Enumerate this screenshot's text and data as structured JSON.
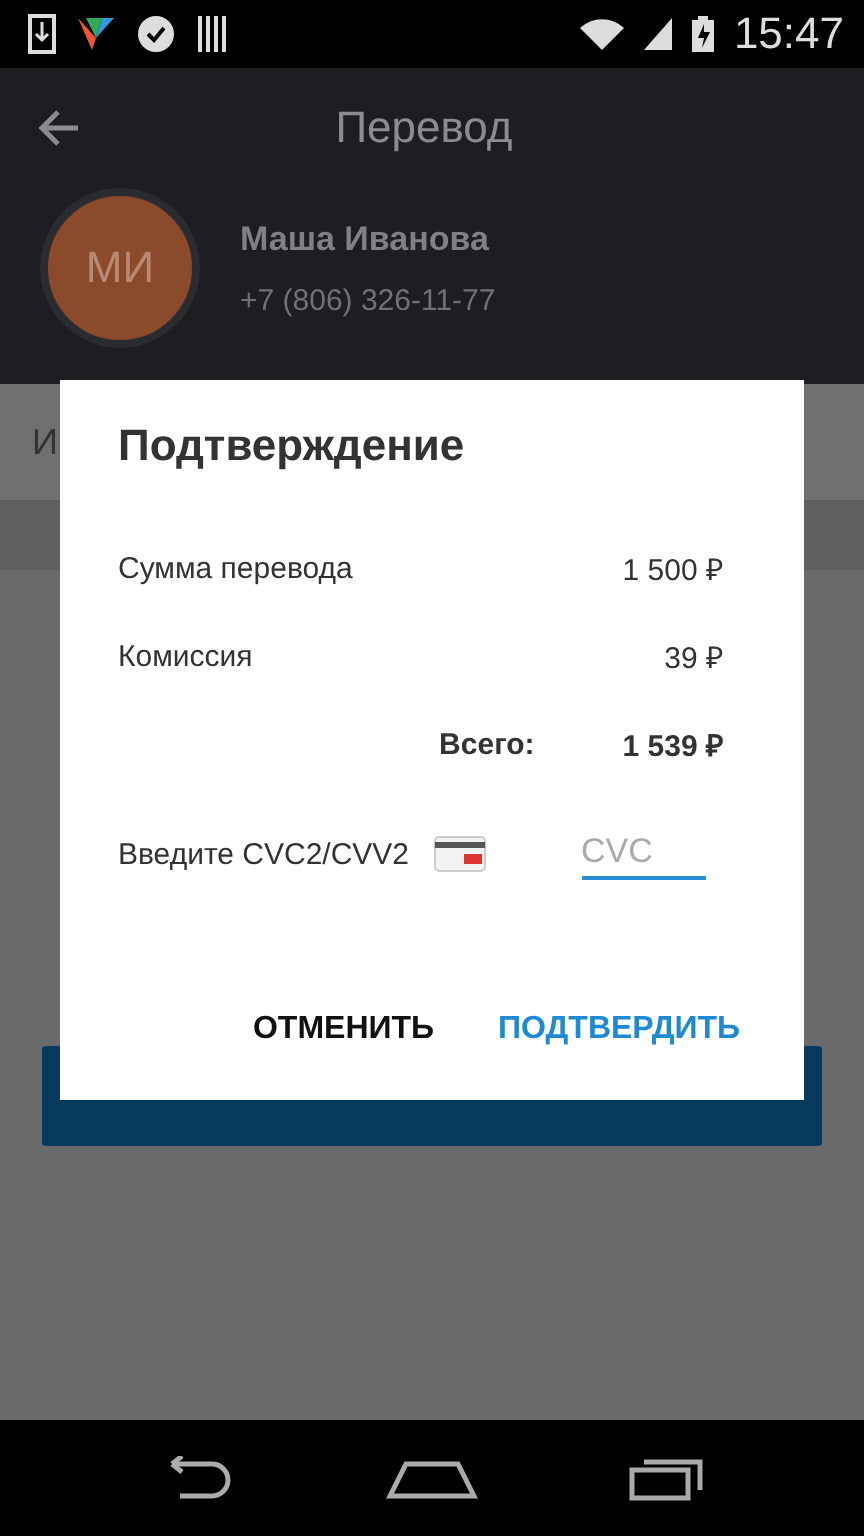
{
  "status_bar": {
    "time": "15:47"
  },
  "toolbar": {
    "title": "Перевод"
  },
  "contact": {
    "initials": "МИ",
    "name": "Маша Иванова",
    "phone": "+7 (806) 326-11-77"
  },
  "tab_row": {
    "label": "И"
  },
  "dialog": {
    "title": "Подтверждение",
    "rows": [
      {
        "kind": "line",
        "label": "Сумма перевода",
        "value": "1 500 ₽"
      },
      {
        "kind": "line",
        "label": "Комиссия",
        "value": "39 ₽"
      },
      {
        "kind": "total",
        "label": "Всего:",
        "value": "1 539 ₽"
      }
    ],
    "cvc": {
      "label": "Введите CVC2/CVV2",
      "placeholder": "CVC"
    },
    "buttons": [
      {
        "kind": "cancel",
        "label": "ОТМЕНИТЬ"
      },
      {
        "kind": "confirm",
        "label": "ПОДТВЕРДИТЬ"
      }
    ]
  }
}
